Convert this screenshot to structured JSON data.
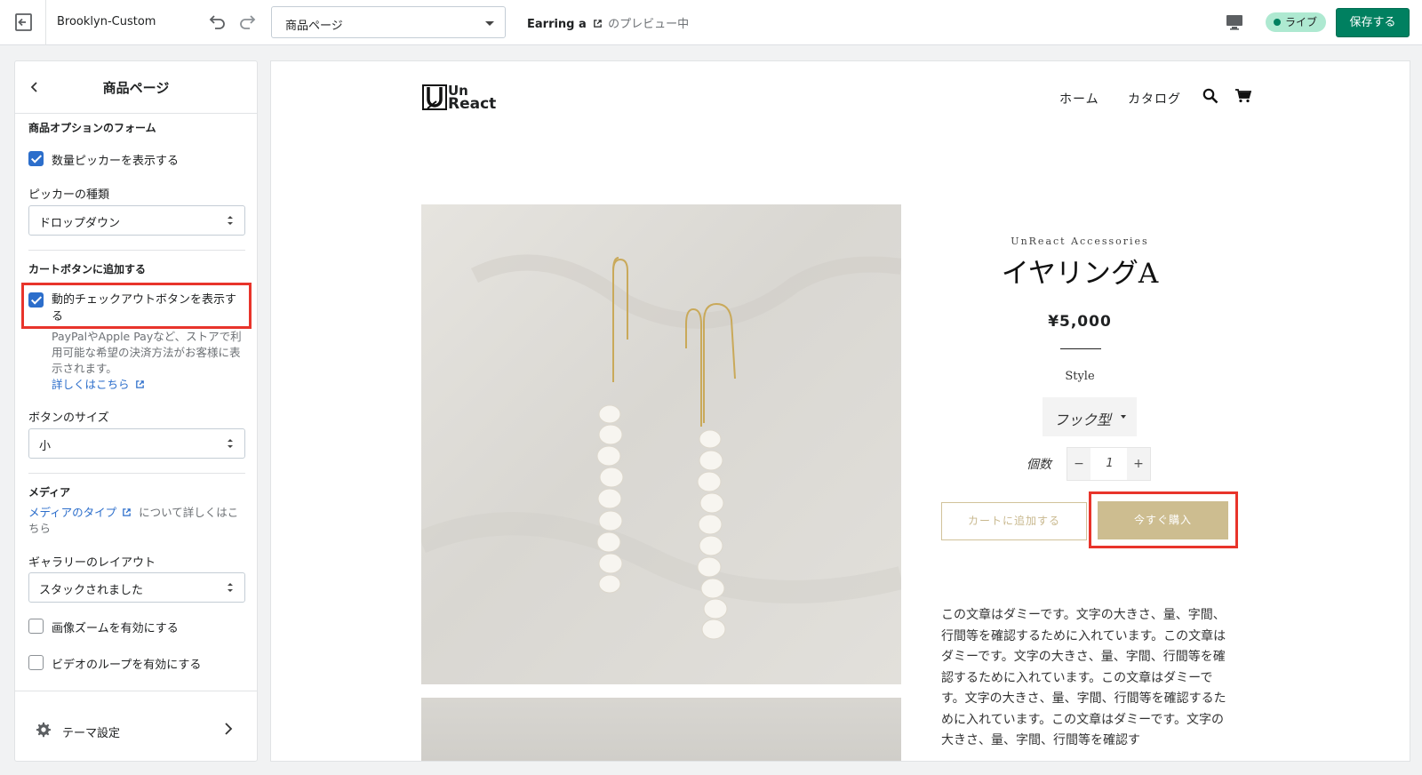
{
  "topbar": {
    "theme_name": "Brooklyn-Custom",
    "page_select": "商品ページ",
    "preview_product": "Earring a",
    "preview_suffix": "のプレビュー中",
    "live_badge": "ライブ",
    "save_label": "保存する"
  },
  "sidebar": {
    "title": "商品ページ",
    "section_options_title": "商品オプションのフォーム",
    "show_qty_picker": {
      "label": "数量ピッカーを表示する",
      "checked": true
    },
    "picker_type_label": "ピッカーの種類",
    "picker_type_value": "ドロップダウン",
    "section_cart_title": "カートボタンに追加する",
    "dynamic_checkout": {
      "label_line1": "動的チェックアウトボタンを表示す",
      "label_line2": "る",
      "checked": true
    },
    "dynamic_checkout_help": "PayPalやApple Payなど、ストアで利用可能な希望の決済方法がお客様に表示されます。",
    "learn_more_link": "詳しくはこちら",
    "button_size_label": "ボタンのサイズ",
    "button_size_value": "小",
    "section_media_title": "メディア",
    "media_type_link": "メディアのタイプ",
    "media_type_suffix": "について詳しくはこちら",
    "gallery_layout_label": "ギャラリーのレイアウト",
    "gallery_layout_value": "スタックされました",
    "enable_zoom": {
      "label": "画像ズームを有効にする",
      "checked": false
    },
    "enable_video_loop": {
      "label": "ビデオのループを有効にする",
      "checked": false
    },
    "theme_settings_label": "テーマ設定"
  },
  "store": {
    "logo_line1": "Un",
    "logo_line2": "React",
    "nav": [
      "ホーム",
      "カタログ"
    ],
    "vendor": "UnReact Accessories",
    "product_title": "イヤリングA",
    "price": "¥5,000",
    "option_label": "Style",
    "option_value": "フック型",
    "quantity_label": "個数",
    "quantity_value": "1",
    "qty_minus": "−",
    "qty_plus": "+",
    "add_to_cart": "カートに追加する",
    "buy_now": "今すぐ購入",
    "description": "この文章はダミーです。文字の大きさ、量、字間、行間等を確認するために入れています。この文章はダミーです。文字の大きさ、量、字間、行間等を確認するために入れています。この文章はダミーです。文字の大きさ、量、字間、行間等を確認するために入れています。この文章はダミーです。文字の大きさ、量、字間、行間等を確認す"
  },
  "colors": {
    "save_button": "#008060",
    "live_badge": "#aee9d1",
    "checkbox_checked": "#2c6ecb",
    "highlight_box": "#e8342b",
    "buy_button": "#cdbd90"
  },
  "icons": [
    "exit-icon",
    "undo-icon",
    "redo-icon",
    "monitor-icon",
    "back-chevron-icon",
    "updown-arrows-icon",
    "external-link-icon",
    "gear-icon",
    "chevron-right-icon",
    "search-icon",
    "cart-icon"
  ]
}
